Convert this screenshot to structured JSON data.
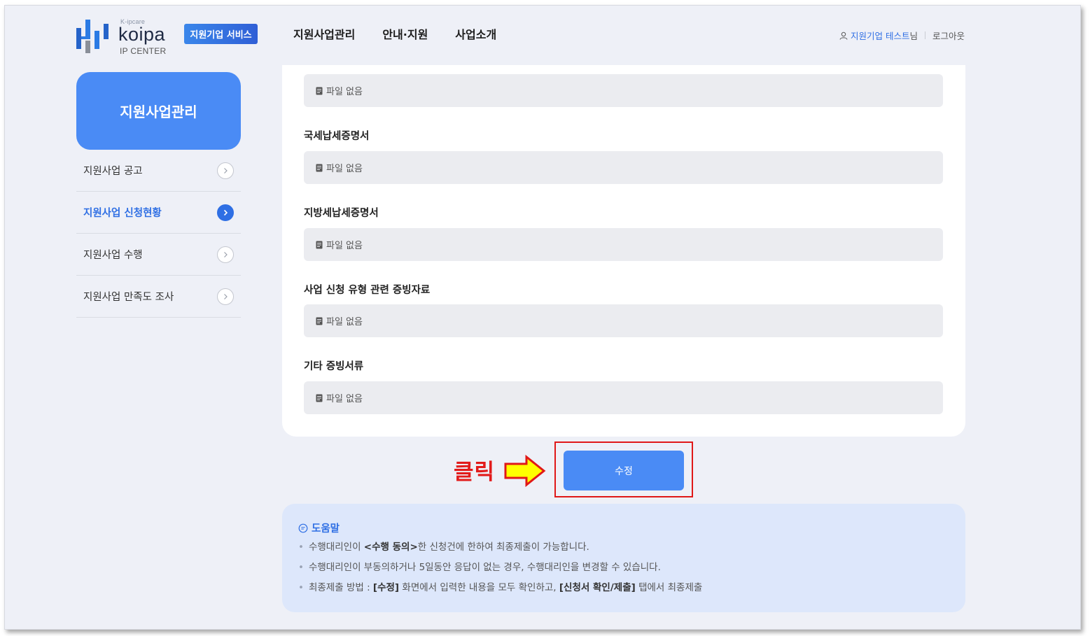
{
  "header": {
    "brand_small": "K-ipcare",
    "brand_name": "koipa",
    "brand_sub": "IP CENTER",
    "service_badge": "지원기업 서비스",
    "nav": [
      "지원사업관리",
      "안내·지원",
      "사업소개"
    ],
    "user_name": "지원기업 테스트",
    "user_suffix": "님",
    "logout": "로그아웃"
  },
  "sidebar": {
    "title": "지원사업관리",
    "items": [
      {
        "label": "지원사업 공고",
        "active": false
      },
      {
        "label": "지원사업 신청현황",
        "active": true
      },
      {
        "label": "지원사업 수행",
        "active": false
      },
      {
        "label": "지원사업 만족도 조사",
        "active": false
      }
    ]
  },
  "files": {
    "no_file_text": "파일 없음",
    "labels": [
      "국세납세증명서",
      "지방세납세증명서",
      "사업 신청 유형 관련 증빙자료",
      "기타 증빙서류"
    ]
  },
  "annotation": {
    "click_label": "클릭"
  },
  "actions": {
    "edit_button": "수정"
  },
  "help": {
    "title": "도움말",
    "line1_a": "수행대리인이 ",
    "line1_b": "<수행 동의>",
    "line1_c": "한 신청건에 한하여 최종제출이 가능합니다.",
    "line2": "수행대리인이 부동의하거나 5일동안 응답이 없는 경우, 수행대리인을 변경할 수 있습니다.",
    "line3_a": "최종제출 방법 : ",
    "line3_b": "[수정]",
    "line3_c": " 화면에서 입력한 내용을 모두 확인하고, ",
    "line3_d": "[신청서 확인/제출]",
    "line3_e": " 탭에서 최종제출"
  },
  "colors": {
    "accent": "#4a8bf5",
    "link": "#2f6fe4",
    "annotation_red": "#e21b1b",
    "arrow_yellow": "#ffff00"
  }
}
